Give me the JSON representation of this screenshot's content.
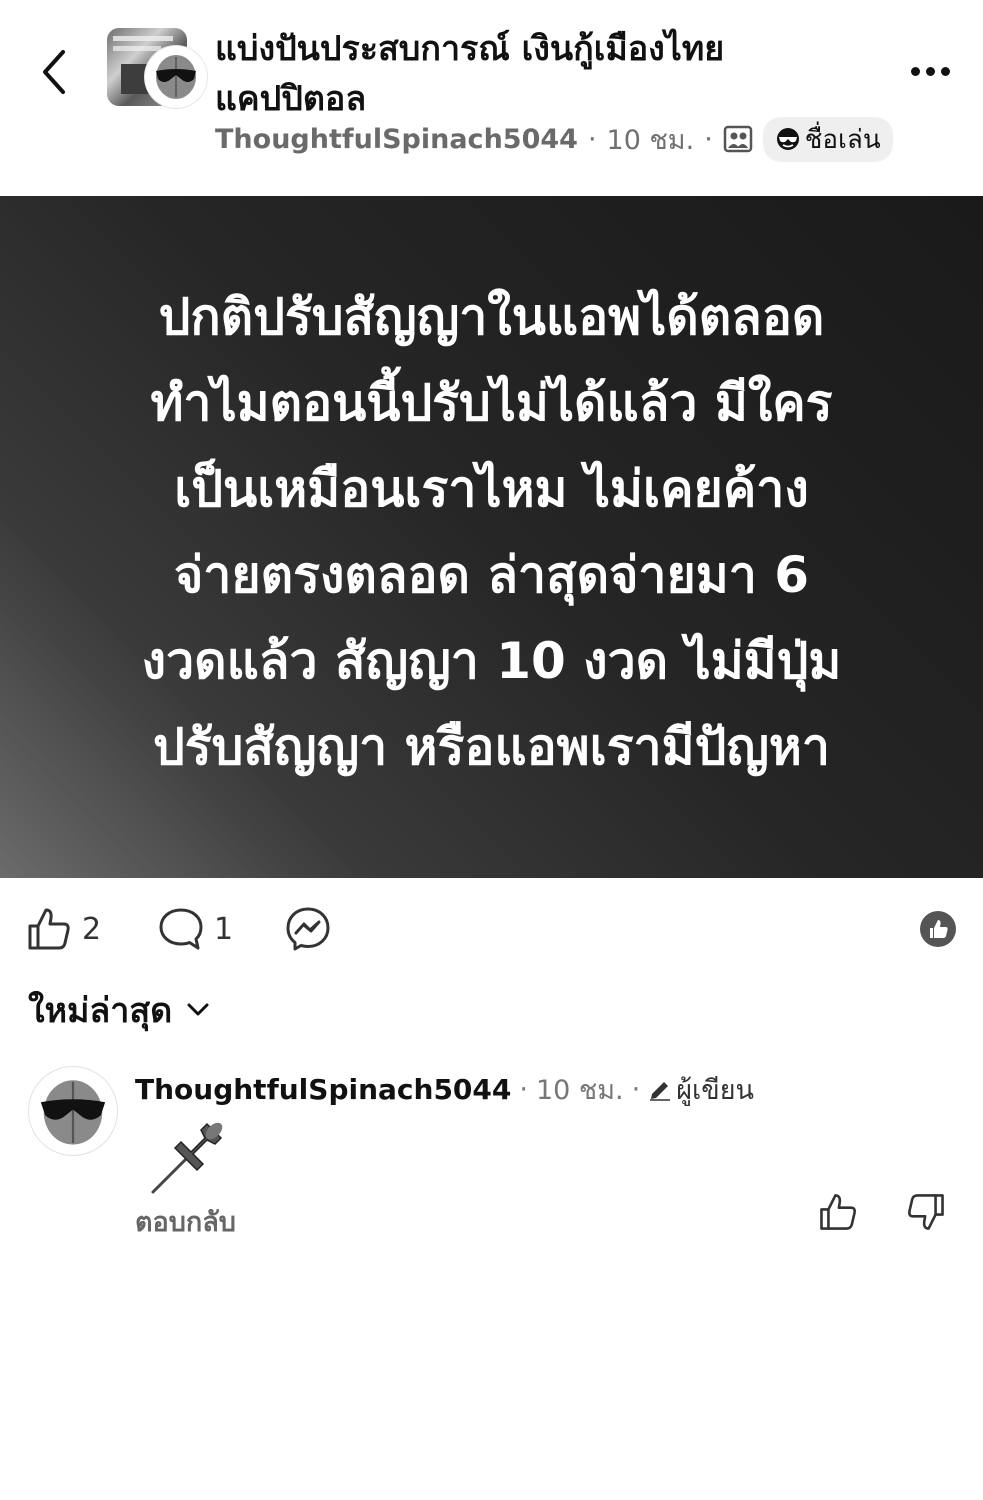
{
  "header": {
    "group_title_line1": "แบ่งปันประสบการณ์ เงินกู้เมืองไทย",
    "group_title_line2": "แคปปิตอล",
    "author": "ThoughtfulSpinach5044",
    "time": "10 ชม.",
    "separator": "·",
    "flair": "ชื่อเล่น",
    "icons": [
      "back-arrow",
      "group-icon",
      "sunglasses-emoji",
      "more-dots"
    ]
  },
  "post": {
    "lines": [
      "ปกติปรับสัญญาในแอพได้ตลอด",
      "ทำไมตอนนี้ปรับไม่ได้แล้ว มีใคร",
      "เป็นเหมือนเราไหม ไม่เคยค้าง",
      "จ่ายตรงตลอด ล่าสุดจ่ายมา 6",
      "งวดแล้ว สัญญา 10 งวด ไม่มีปุ่ม",
      "ปรับสัญญา หรือแอพเรามีปัญหา"
    ]
  },
  "actions": {
    "like_count": "2",
    "comment_count": "1"
  },
  "sort": {
    "label": "ใหม่ล่าสุด"
  },
  "comment": {
    "author": "ThoughtfulSpinach5044",
    "separator": "·",
    "time": "10 ชม.",
    "role": "ผู้เขียน",
    "content_emoji": "pushpin",
    "reply_label": "ตอบกลับ"
  },
  "colors": {
    "text": "#111111",
    "muted": "#707070",
    "post_bg_dark": "#1f1f1f",
    "post_bg_light": "#6b6b6b"
  }
}
